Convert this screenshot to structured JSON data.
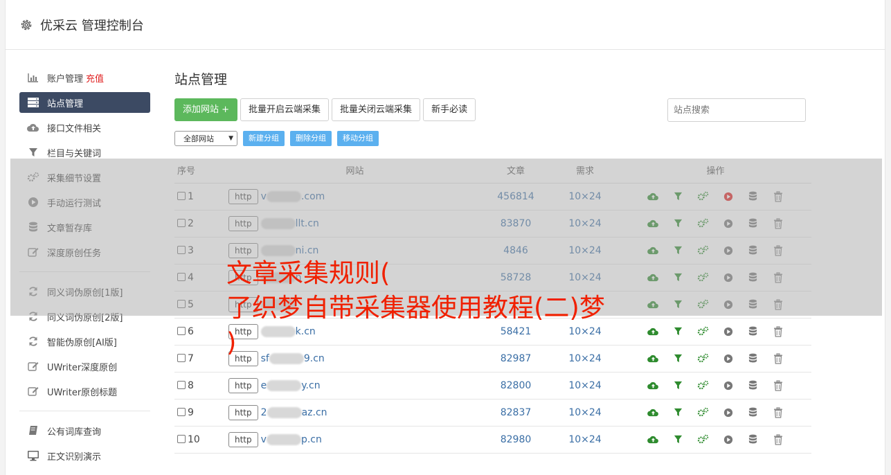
{
  "header": {
    "title": "优采云 管理控制台"
  },
  "sidebar": {
    "group1": [
      {
        "label": "账户管理",
        "extra": "充值",
        "icon": "bar-chart-icon",
        "active": false
      },
      {
        "label": "站点管理",
        "icon": "server-icon",
        "active": true
      },
      {
        "label": "接口文件相关",
        "icon": "cloud-upload-icon",
        "active": false
      },
      {
        "label": "栏目与关键词",
        "icon": "filter-icon",
        "active": false
      },
      {
        "label": "采集细节设置",
        "icon": "cogs-icon",
        "active": false
      },
      {
        "label": "手动运行测试",
        "icon": "play-circle-icon",
        "active": false
      },
      {
        "label": "文章暂存库",
        "icon": "database-icon",
        "active": false
      },
      {
        "label": "深度原创任务",
        "icon": "edit-icon",
        "active": false
      }
    ],
    "group2": [
      {
        "label": "同义词伪原创[1版]",
        "icon": "refresh-icon"
      },
      {
        "label": "同义词伪原创[2版]",
        "icon": "refresh-icon"
      },
      {
        "label": "智能伪原创[AI版]",
        "icon": "refresh-icon"
      },
      {
        "label": "UWriter深度原创",
        "icon": "edit-icon"
      },
      {
        "label": "UWriter原创标题",
        "icon": "edit-icon"
      }
    ],
    "group3": [
      {
        "label": "公有词库查询",
        "icon": "book-icon"
      },
      {
        "label": "正文识别演示",
        "icon": "monitor-icon"
      }
    ]
  },
  "main": {
    "title": "站点管理",
    "buttons": {
      "add": "添加网站 +",
      "batch_on": "批量开启云端采集",
      "batch_off": "批量关闭云端采集",
      "guide": "新手必读"
    },
    "search_placeholder": "站点搜索",
    "group_select": "全部网站",
    "group_buttons": {
      "new": "新建分组",
      "delete": "删除分组",
      "move": "移动分组"
    },
    "table": {
      "headers": [
        "序号",
        "网站",
        "文章",
        "需求",
        "操作"
      ],
      "rows": [
        {
          "idx": "1",
          "proto": "http",
          "pre": "v",
          "post": ".com",
          "count": "456814",
          "need": "10×24",
          "play_red": true
        },
        {
          "idx": "2",
          "proto": "http",
          "pre": "",
          "post": "llt.cn",
          "count": "83870",
          "need": "10×24",
          "play_red": false
        },
        {
          "idx": "3",
          "proto": "http",
          "pre": "",
          "post": "ni.cn",
          "count": "4846",
          "need": "10×24",
          "play_red": false
        },
        {
          "idx": "4",
          "proto": "http",
          "pre": "",
          "post": "n",
          "count": "58728",
          "need": "10×24",
          "play_red": false
        },
        {
          "idx": "5",
          "proto": "http",
          "pre": "",
          "post": "",
          "count": "",
          "need": "",
          "play_red": false
        },
        {
          "idx": "6",
          "proto": "http",
          "pre": "",
          "post": "k.cn",
          "count": "58421",
          "need": "10×24",
          "play_red": false
        },
        {
          "idx": "7",
          "proto": "http",
          "pre": "sf",
          "post": "9.cn",
          "count": "82987",
          "need": "10×24",
          "play_red": false
        },
        {
          "idx": "8",
          "proto": "http",
          "pre": "e",
          "post": "y.cn",
          "count": "82800",
          "need": "10×24",
          "play_red": false
        },
        {
          "idx": "9",
          "proto": "http",
          "pre": "2",
          "post": "az.cn",
          "count": "82837",
          "need": "10×24",
          "play_red": false
        },
        {
          "idx": "10",
          "proto": "http",
          "pre": "v",
          "post": "p.cn",
          "count": "82980",
          "need": "10×24",
          "play_red": false
        }
      ]
    }
  },
  "overlay": {
    "line1": "文章采集规则(",
    "line2": "了织梦自带采集器使用教程(二)梦",
    "line3": ")"
  },
  "colors": {
    "accent_dark": "#3c4a63",
    "green": "#5cb85c",
    "blue": "#5bb0ef",
    "overlay_red": "#f02000"
  }
}
